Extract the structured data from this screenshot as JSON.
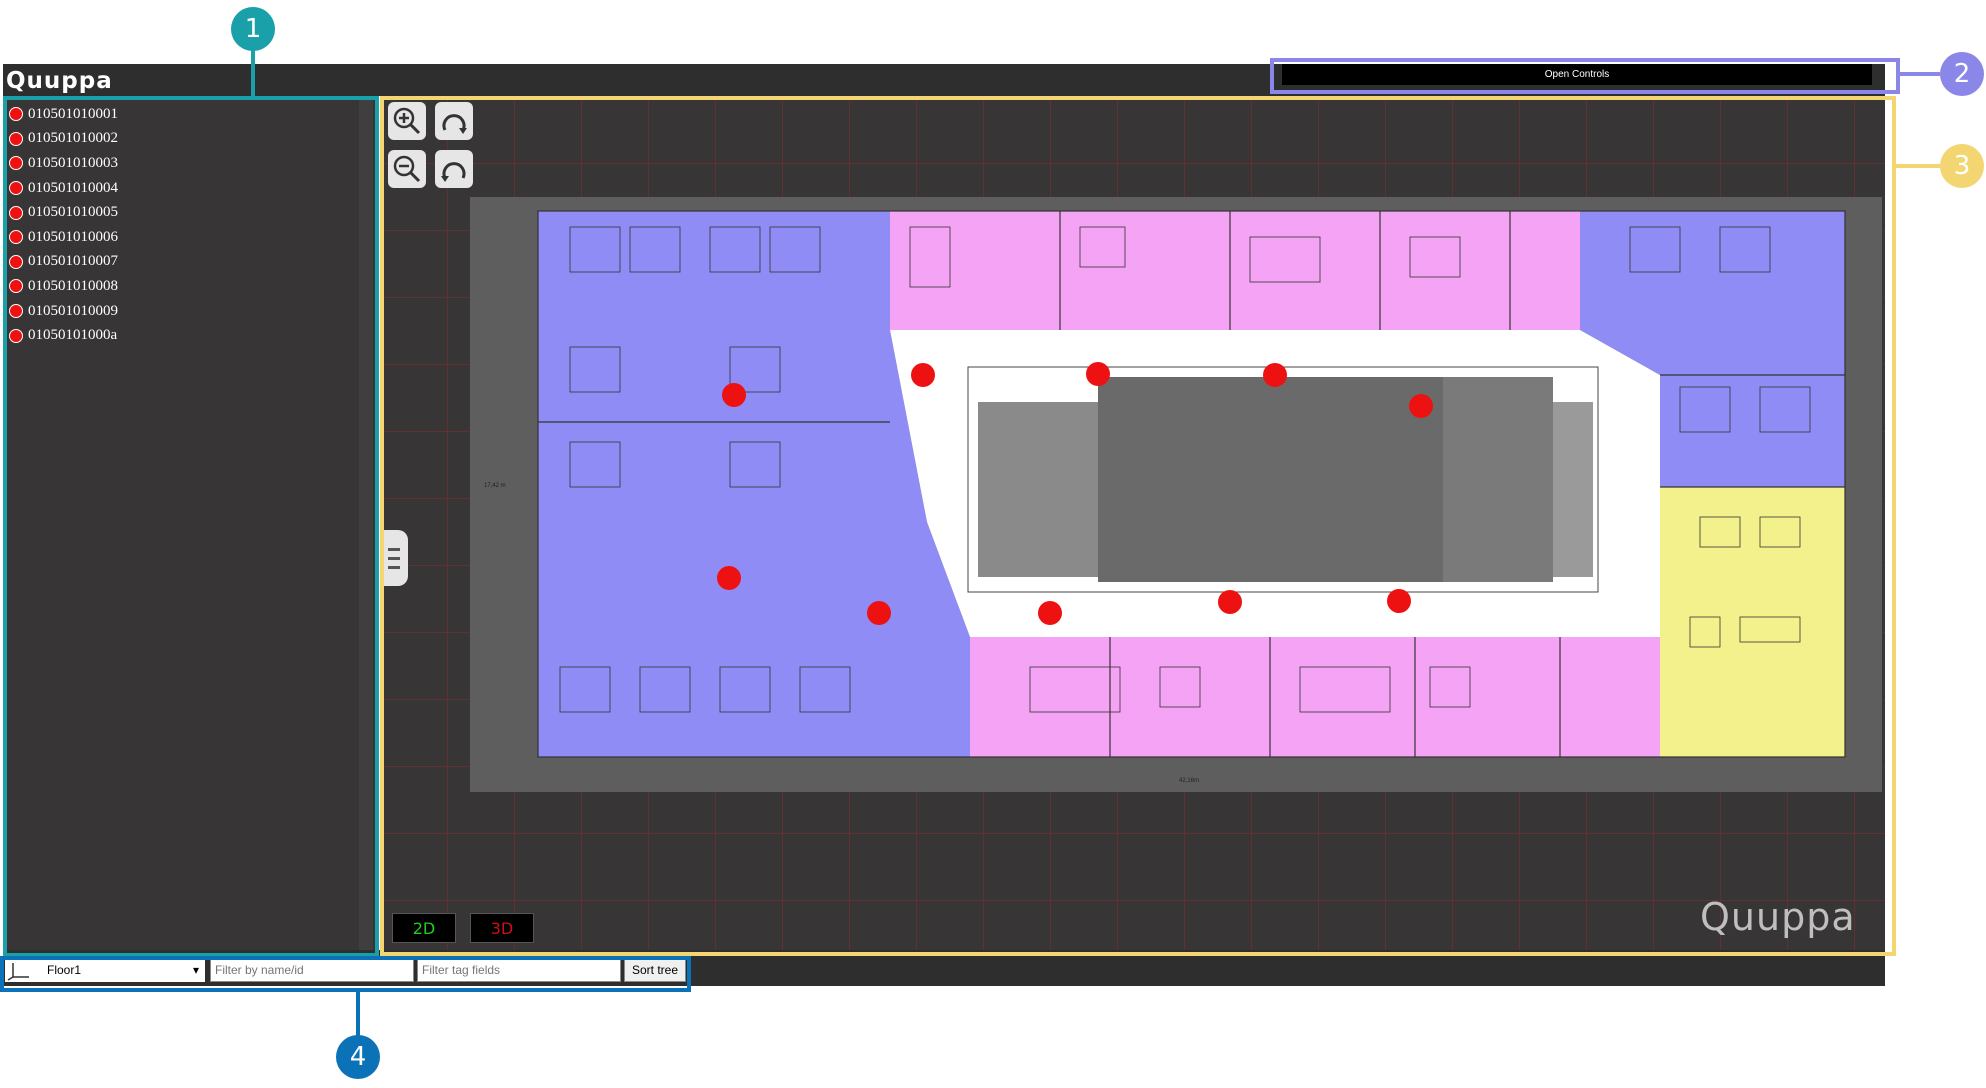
{
  "app": {
    "logo": "Quuppa"
  },
  "header": {
    "open_controls_label": "Open Controls"
  },
  "tags": [
    {
      "id": "010501010001"
    },
    {
      "id": "010501010002"
    },
    {
      "id": "010501010003"
    },
    {
      "id": "010501010004"
    },
    {
      "id": "010501010005"
    },
    {
      "id": "010501010006"
    },
    {
      "id": "010501010007"
    },
    {
      "id": "010501010008"
    },
    {
      "id": "010501010009"
    },
    {
      "id": "01050101000a"
    }
  ],
  "bottom_bar": {
    "floor_select": {
      "selected": "Floor1"
    },
    "filter_name_placeholder": "Filter by name/id",
    "filter_tags_placeholder": "Filter tag fields",
    "sort_label": "Sort tree"
  },
  "map": {
    "btn_2d": "2D",
    "btn_3d": "3D",
    "watermark": "Quuppa",
    "dim_width_label": "42,16m",
    "dim_height_label": "17,42 m",
    "zone_colors": {
      "work": "#8f8cf5",
      "meeting": "#f5a4f5",
      "lounge": "#f3f18b",
      "corridor": "#ffffff",
      "tag": "#ee1111"
    }
  },
  "annotations": {
    "callout_1": "1",
    "callout_2": "2",
    "callout_3": "3",
    "callout_4": "4",
    "colors": {
      "c1": "#1aa0a8",
      "c2": "#8a87e8",
      "c3": "#f3d672",
      "c4": "#0b72b8"
    }
  }
}
